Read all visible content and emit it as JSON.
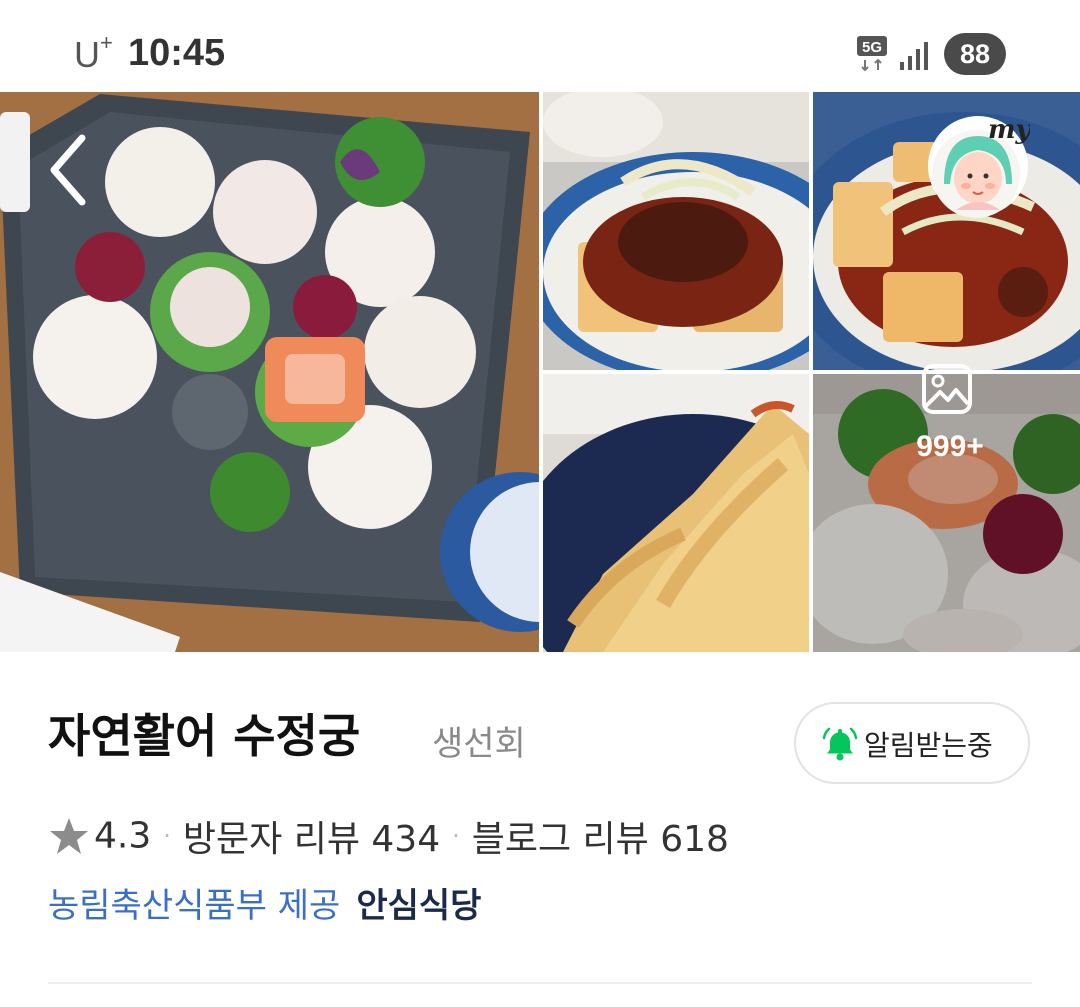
{
  "status_bar": {
    "carrier": "U",
    "carrier_sup": "+",
    "time": "10:45",
    "network": "5G",
    "battery": "88"
  },
  "gallery": {
    "more_count": "999+",
    "photos": [
      "sashimi-platter-photo",
      "braised-tofu-photo",
      "spicy-braised-fish-photo",
      "tempura-photo",
      "sashimi-closeup-photo"
    ]
  },
  "place": {
    "name": "자연활어 수정궁",
    "category": "생선회",
    "notify_label": "알림받는중",
    "rating": "4.3",
    "visitor_reviews": "방문자 리뷰 434",
    "blog_reviews": "블로그 리뷰 618",
    "dot": "·",
    "provider": "농림축산식품부 제공",
    "badge": "안심식당"
  },
  "colors": {
    "bell": "#03c75a",
    "provider_link": "#3b6fc4",
    "avatar_hair": "#5fcfb3"
  },
  "icons": {
    "back": "chevron-left-icon",
    "avatar": "my-avatar-icon",
    "more_photos": "image-icon",
    "notify": "bell-icon",
    "rating": "star-icon"
  }
}
